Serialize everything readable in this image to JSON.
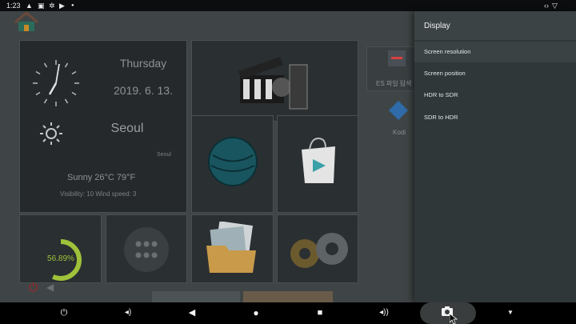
{
  "status_bar": {
    "time": "1:23",
    "icons": [
      "alert-icon",
      "a-icon",
      "settings-icon",
      "play-icon",
      "dot-icon"
    ],
    "right_icons": [
      "connection-icon",
      "wifi-icon"
    ]
  },
  "launcher": {
    "weekday": "Thursday",
    "date": "2019. 6. 13.",
    "city": "Seoul",
    "city_small": "Seoul",
    "weather": "Sunny  26°C  79°F",
    "details": "Visibility: 10   Wind speed: 3",
    "ram_usage": "56.89%",
    "ram_fraction": 0.5689,
    "apps": {
      "es_label": "ES 파일 탐색",
      "kodi_label": "Kodi"
    }
  },
  "drawer": {
    "title": "Display",
    "items": [
      {
        "label": "Screen resolution"
      },
      {
        "label": "Screen position"
      },
      {
        "label": "HDR to SDR"
      },
      {
        "label": "SDR to HDR"
      }
    ]
  },
  "navbar": {
    "buttons": [
      "power-icon",
      "volume-down-icon",
      "back-icon",
      "home-icon",
      "recents-icon",
      "volume-up-icon",
      "screenshot-icon",
      "dropdown-icon"
    ]
  },
  "colors": {
    "drawer_bg": "#2f3739",
    "ram_ring": "#9fc23a",
    "power": "#b02020"
  }
}
